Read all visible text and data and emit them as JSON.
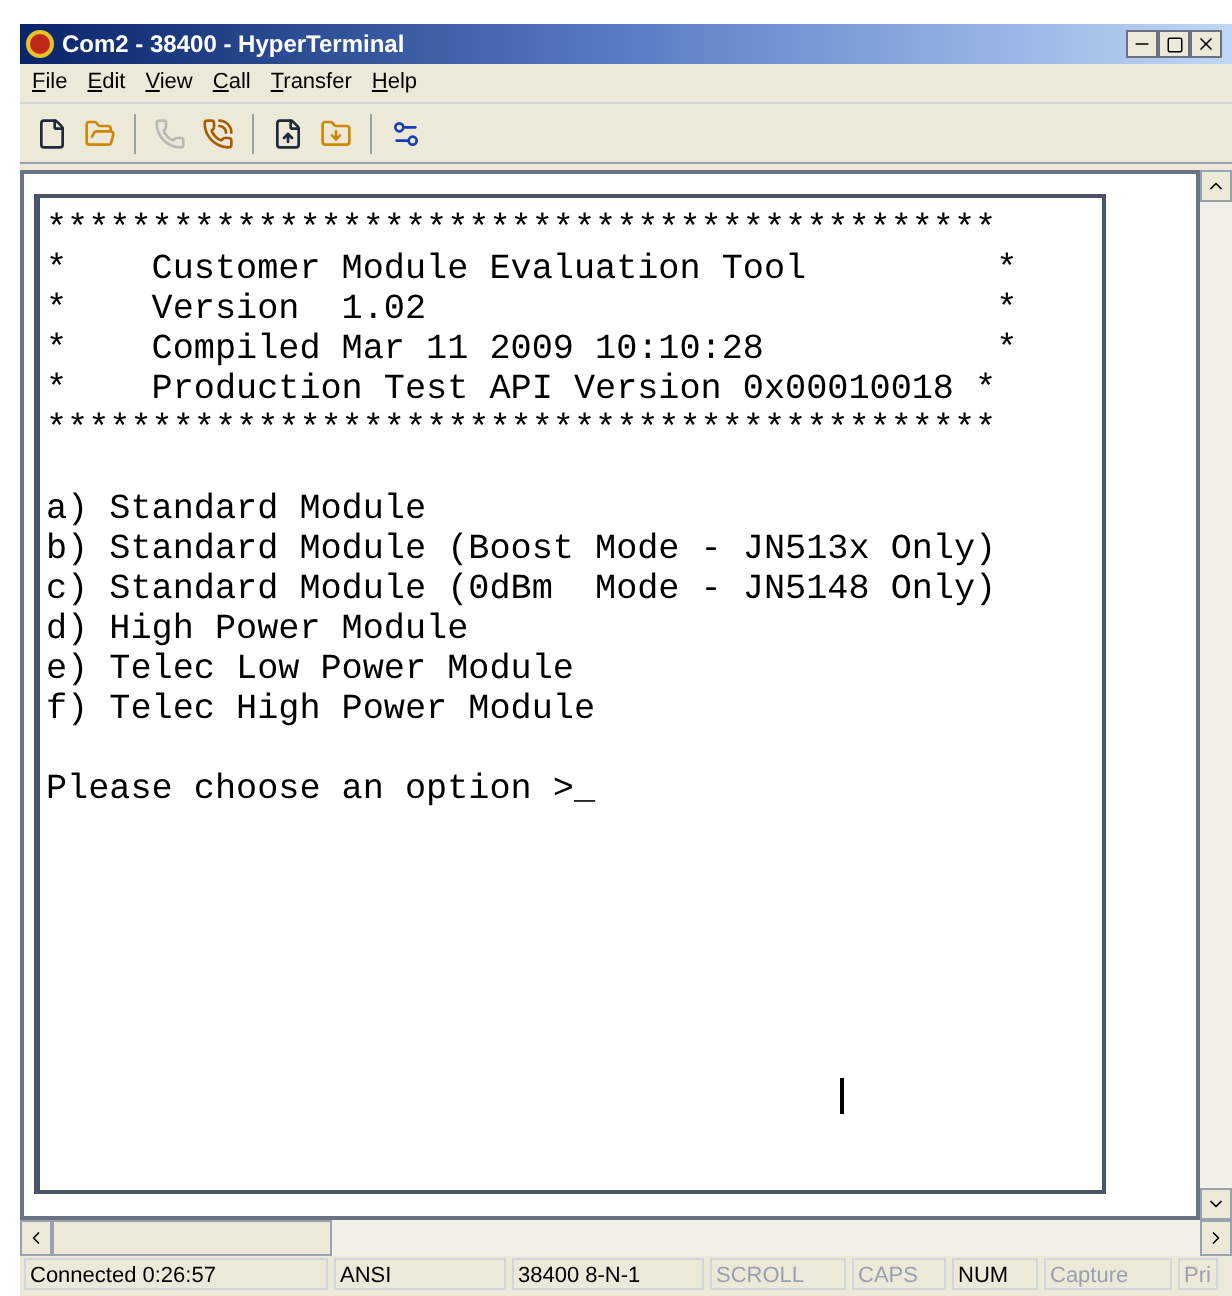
{
  "window": {
    "title": "Com2 - 38400 - HyperTerminal"
  },
  "menu": [
    "File",
    "Edit",
    "View",
    "Call",
    "Transfer",
    "Help"
  ],
  "toolbar": [
    {
      "kind": "new",
      "disabled": false
    },
    {
      "kind": "open",
      "disabled": false
    },
    {
      "kind": "separator"
    },
    {
      "kind": "disconnect",
      "disabled": true
    },
    {
      "kind": "dial",
      "disabled": false
    },
    {
      "kind": "separator"
    },
    {
      "kind": "send",
      "disabled": false
    },
    {
      "kind": "receive",
      "disabled": false
    },
    {
      "kind": "separator"
    },
    {
      "kind": "properties",
      "disabled": false
    }
  ],
  "terminal": {
    "blocks": [
      [
        "*********************************************",
        "*    Customer Module Evaluation Tool         *",
        "*    Version  1.02                           *",
        "*    Compiled Mar 11 2009 10:10:28           *",
        "*    Production Test API Version 0x00010018 *",
        "*********************************************"
      ],
      [
        "a) Standard Module",
        "b) Standard Module (Boost Mode - JN513x Only)",
        "c) Standard Module (0dBm  Mode - JN5148 Only)",
        "d) High Power Module",
        "e) Telec Low Power Module",
        "f) Telec High Power Module"
      ],
      [
        "Please choose an option >_"
      ]
    ]
  },
  "status_bar": [
    {
      "text": "Connected 0:26:57",
      "active": true
    },
    {
      "text": "ANSI",
      "active": true
    },
    {
      "text": "38400 8-N-1",
      "active": true
    },
    {
      "text": "SCROLL",
      "active": false
    },
    {
      "text": "CAPS",
      "active": false
    },
    {
      "text": "NUM",
      "active": true
    },
    {
      "text": "Capture",
      "active": false
    },
    {
      "text": "Pri",
      "active": false
    }
  ]
}
